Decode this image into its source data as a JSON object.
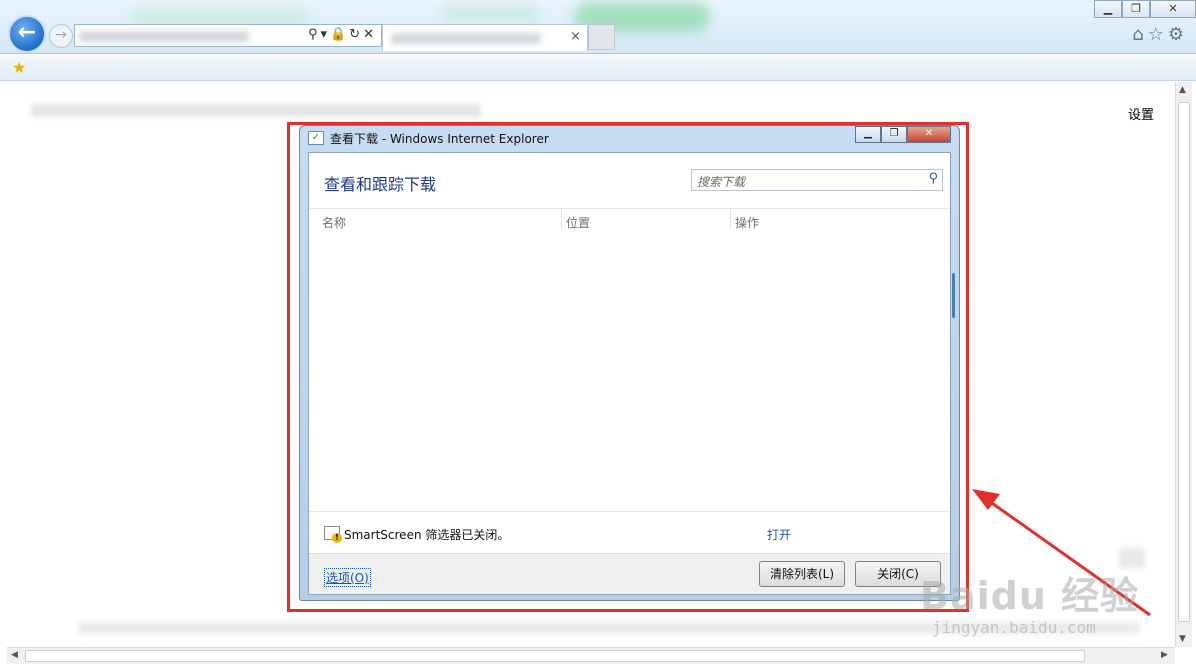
{
  "browser": {
    "back_glyph": "←",
    "forward_glyph": "→",
    "address_icons": "⚲▾🔒↻✕",
    "tab_close": "×",
    "window_buttons": {
      "minimize": "▁",
      "maximize": "❐",
      "close": "✕"
    },
    "tool_icons": "⌂☆⚙",
    "favorites_icon": "star-add-icon"
  },
  "page": {
    "settings_label": "设置"
  },
  "dialog": {
    "title": "查看下载 - Windows Internet Explorer",
    "heading": "查看和跟踪下载",
    "search_placeholder": "搜索下载",
    "columns": [
      "名称",
      "位置",
      "操作"
    ],
    "smartscreen_text": "SmartScreen 筛选器已关闭。",
    "smartscreen_action": "打开",
    "options_link": "选项(O)",
    "clear_button": "清除列表(L)",
    "close_button": "关闭(C)",
    "buttons": {
      "minimize": "▁",
      "maximize": "❐",
      "close": "✕"
    }
  },
  "annotation": {
    "highlight_color": "#e2302a"
  },
  "watermark": {
    "logo": "Baidu 经验",
    "url": "jingyan.baidu.com"
  }
}
